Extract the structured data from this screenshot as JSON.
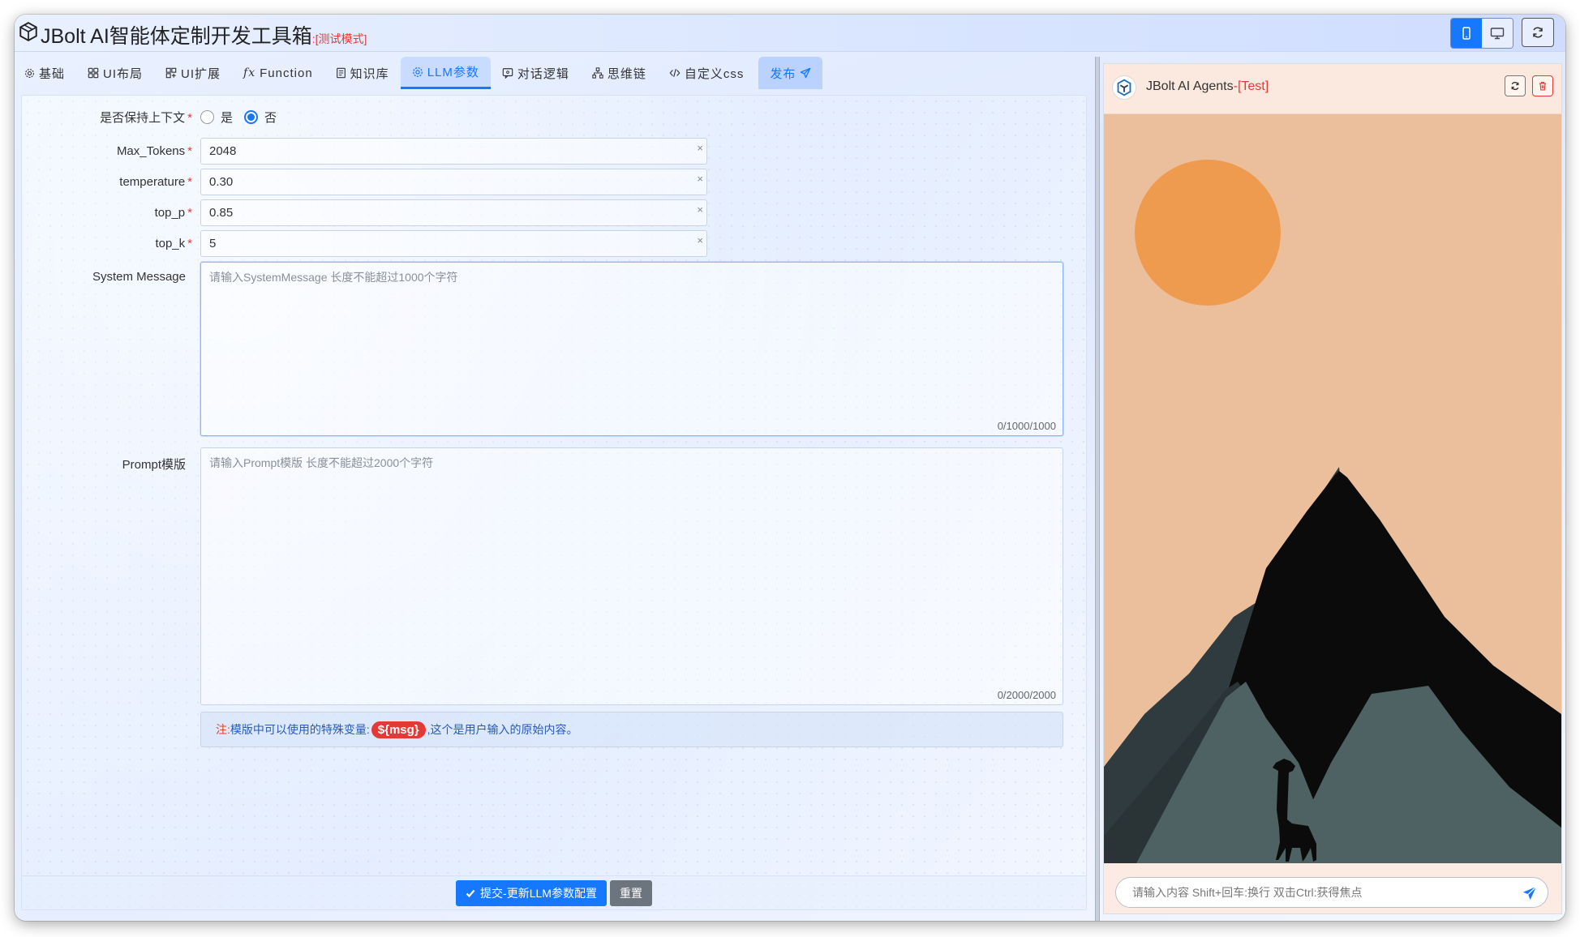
{
  "app": {
    "title": "JBolt AI智能体定制开发工具箱",
    "mode_label": ":[测试模式]"
  },
  "titlebar_buttons": [
    {
      "icon": "mobile-icon",
      "active": true
    },
    {
      "icon": "desktop-icon",
      "active": false
    },
    {
      "icon": "refresh-icon",
      "active": false
    }
  ],
  "tabs": [
    {
      "label": "基础",
      "icon": "gear-icon"
    },
    {
      "label": "UI布局",
      "icon": "grid-icon"
    },
    {
      "label": "UI扩展",
      "icon": "grid-plus-icon"
    },
    {
      "label": "Function",
      "icon": "fx-icon"
    },
    {
      "label": "知识库",
      "icon": "book-icon"
    },
    {
      "label": "LLM参数",
      "icon": "cog-icon",
      "active": true
    },
    {
      "label": "对话逻辑",
      "icon": "chat-icon"
    },
    {
      "label": "思维链",
      "icon": "tree-icon"
    },
    {
      "label": "自定义css",
      "icon": "code-icon"
    },
    {
      "label": "发布",
      "icon": "send-icon"
    }
  ],
  "form": {
    "keep_context": {
      "label": "是否保持上下文",
      "options": [
        "是",
        "否"
      ],
      "selected": "否"
    },
    "max_tokens": {
      "label": "Max_Tokens",
      "value": "2048"
    },
    "temperature": {
      "label": "temperature",
      "value": "0.30"
    },
    "top_p": {
      "label": "top_p",
      "value": "0.85"
    },
    "top_k": {
      "label": "top_k",
      "value": "5"
    },
    "system_message": {
      "label": "System Message",
      "placeholder": "请输入SystemMessage 长度不能超过1000个字符",
      "counter": "0/1000/1000"
    },
    "prompt_template": {
      "label": "Prompt模版",
      "placeholder": "请输入Prompt模版 长度不能超过2000个字符",
      "counter": "0/2000/2000"
    },
    "note": {
      "prefix": "注:",
      "text_before": "模版中可以使用的特殊变量:",
      "variable": "${msg}",
      "text_after": ",这个是用户输入的原始内容。"
    },
    "submit_label": "提交-更新LLM参数配置",
    "reset_label": "重置",
    "clear_glyph": "×",
    "required_mark": "*"
  },
  "chat": {
    "title": "JBolt AI Agents",
    "title_suffix": "-[Test]",
    "input_placeholder": "请输入内容 Shift+回车:换行 双击Ctrl:获得焦点",
    "colors": {
      "sky": "#ecbf9c",
      "sun": "#ee9a4f",
      "mountain_dark": "#2f3b3f",
      "mountain_mid": "#4e6163",
      "peak_black": "#0b0b0b"
    }
  }
}
